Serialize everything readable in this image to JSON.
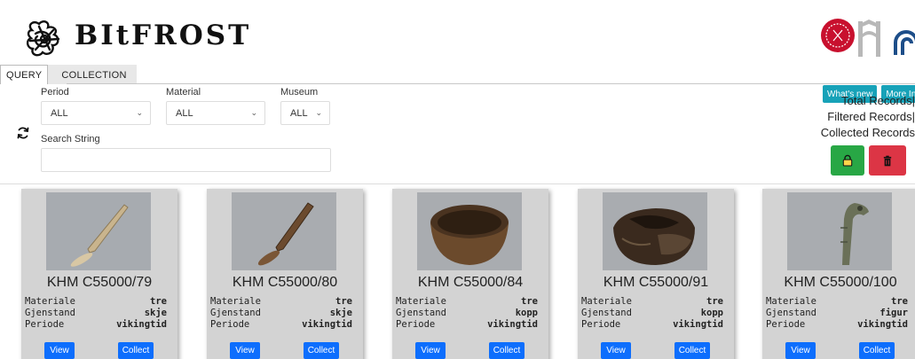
{
  "header": {
    "brand": "BItFROST",
    "buttons": {
      "whats_new": "What's new",
      "more_info": "More In"
    }
  },
  "tabs": [
    {
      "label": "QUERY",
      "active": true
    },
    {
      "label": "COLLECTION",
      "active": false
    }
  ],
  "filters": {
    "period": {
      "label": "Period",
      "value": "ALL"
    },
    "material": {
      "label": "Material",
      "value": "ALL"
    },
    "museum": {
      "label": "Museum",
      "value": "ALL"
    },
    "search": {
      "label": "Search String",
      "value": "",
      "placeholder": ""
    }
  },
  "stats": {
    "total": "Total Records|",
    "filtered": "Filtered Records|",
    "collected": "Collected Records"
  },
  "colors": {
    "accent_teal": "#17a2b8",
    "lock_green": "#28a745",
    "delete_red": "#dc3545",
    "action_blue": "#0d6efd"
  },
  "attribute_labels": {
    "material": "Materiale",
    "object": "Gjenstand",
    "period": "Periode"
  },
  "card_buttons": {
    "view": "View",
    "collect": "Collect"
  },
  "cards": [
    {
      "title": "KHM C55000/79",
      "material": "tre",
      "object": "skje",
      "period": "vikingtid"
    },
    {
      "title": "KHM C55000/80",
      "material": "tre",
      "object": "skje",
      "period": "vikingtid"
    },
    {
      "title": "KHM C55000/84",
      "material": "tre",
      "object": "kopp",
      "period": "vikingtid"
    },
    {
      "title": "KHM C55000/91",
      "material": "tre",
      "object": "kopp",
      "period": "vikingtid"
    },
    {
      "title": "KHM C55000/100",
      "material": "tre",
      "object": "figur",
      "period": "vikingtid"
    }
  ]
}
